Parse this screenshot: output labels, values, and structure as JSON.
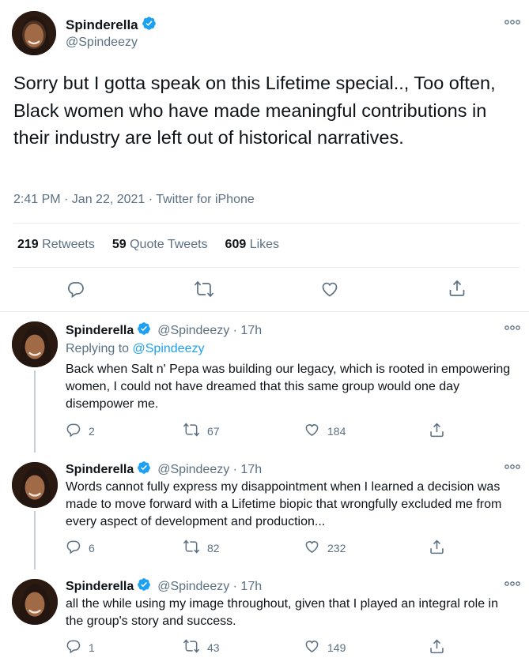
{
  "main_tweet": {
    "display_name": "Spinderella",
    "handle": "@Spindeezy",
    "text": "Sorry but I gotta speak on this Lifetime special.., Too often, Black women who have made meaningful contributions in their industry are left out of historical narratives.",
    "meta": "2:41 PM · Jan 22, 2021 · Twitter for iPhone",
    "stats": [
      {
        "count": "219",
        "label": "Retweets"
      },
      {
        "count": "59",
        "label": "Quote Tweets"
      },
      {
        "count": "609",
        "label": "Likes"
      }
    ]
  },
  "replies": [
    {
      "display_name": "Spinderella",
      "handle_time": "@Spindeezy · 17h",
      "replying_prefix": "Replying to",
      "replying_to": "@Spindeezy",
      "text": "Back when Salt n' Pepa was building our legacy, which is rooted in empowering women, I could not have dreamed that this same group would one day disempower me.",
      "reply_count": "2",
      "retweet_count": "67",
      "like_count": "184"
    },
    {
      "display_name": "Spinderella",
      "handle_time": "@Spindeezy · 17h",
      "text": "Words cannot fully express my disappointment when I learned a decision was made to move forward with a Lifetime biopic that wrongfully excluded me from every aspect of development and production...",
      "reply_count": "6",
      "retweet_count": "82",
      "like_count": "232"
    },
    {
      "display_name": "Spinderella",
      "handle_time": "@Spindeezy · 17h",
      "text": "all the while using my image throughout, given that I played an integral role in the group's story and success.",
      "reply_count": "1",
      "retweet_count": "43",
      "like_count": "149"
    }
  ],
  "icons": {
    "verified": "verified-badge-icon",
    "more": "more-dots-icon",
    "reply": "reply-icon",
    "retweet": "retweet-icon",
    "like": "heart-icon",
    "share": "share-icon"
  },
  "colors": {
    "verified_blue": "#1da1f2",
    "muted": "#5b7083",
    "text": "#0f1419",
    "divider": "#e6ecf0"
  }
}
